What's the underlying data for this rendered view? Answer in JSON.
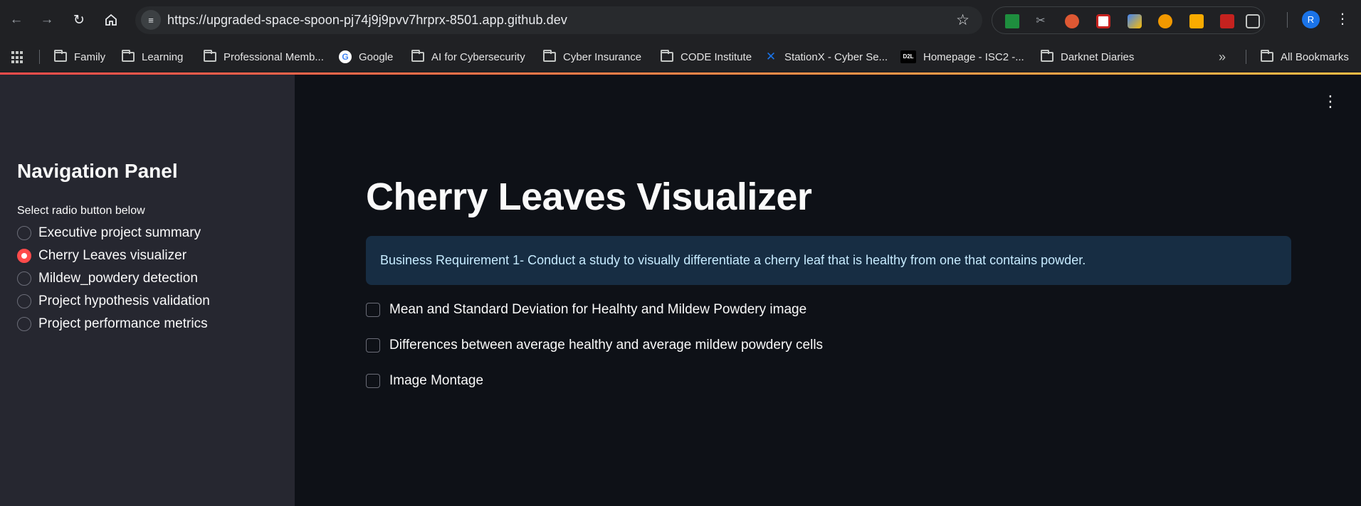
{
  "browser": {
    "url": "https://upgraded-space-spoon-pj74j9j9pvv7hrprx-8501.app.github.dev",
    "profile_initial": "R",
    "bookmarks": [
      {
        "label": "Family",
        "icon": "folder-icon"
      },
      {
        "label": "Learning",
        "icon": "folder-icon"
      },
      {
        "label": "Professional Memb...",
        "icon": "folder-icon"
      },
      {
        "label": "Google",
        "icon": "google-icon"
      },
      {
        "label": "AI for Cybersecurity",
        "icon": "folder-icon"
      },
      {
        "label": "Cyber Insurance",
        "icon": "folder-icon"
      },
      {
        "label": "CODE Institute",
        "icon": "folder-icon"
      },
      {
        "label": "StationX - Cyber Se...",
        "icon": "stationx-icon"
      },
      {
        "label": "Homepage - ISC2 -...",
        "icon": "d2l-icon"
      },
      {
        "label": "Darknet Diaries",
        "icon": "folder-icon"
      }
    ],
    "all_bookmarks_label": "All Bookmarks",
    "d2l_badge": "D2L",
    "google_glyph": "G"
  },
  "sidebar": {
    "title": "Navigation Panel",
    "radio_caption": "Select radio button below",
    "options": [
      {
        "label": "Executive project summary",
        "selected": false
      },
      {
        "label": "Cherry Leaves visualizer",
        "selected": true
      },
      {
        "label": "Mildew_powdery detection",
        "selected": false
      },
      {
        "label": "Project hypothesis validation",
        "selected": false
      },
      {
        "label": "Project performance metrics",
        "selected": false
      }
    ]
  },
  "main": {
    "title": "Cherry Leaves Visualizer",
    "info_text": "Business Requirement 1- Conduct a study to visually differentiate a cherry leaf that is healthy from one that contains powder.",
    "checkboxes": [
      {
        "label": "Mean and Standard Deviation for Healhty and Mildew Powdery image",
        "checked": false
      },
      {
        "label": "Differences between average healthy and average mildew powdery cells",
        "checked": false
      },
      {
        "label": "Image Montage",
        "checked": false
      }
    ]
  },
  "colors": {
    "accent": "#ff4b4b",
    "info_bg": "#172d43",
    "info_text": "#c7ebff",
    "sidebar_bg": "#262730",
    "main_bg": "#0e1117"
  }
}
